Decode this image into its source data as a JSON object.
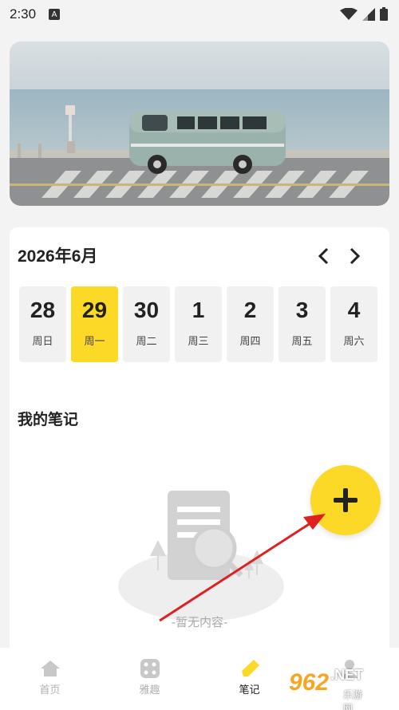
{
  "status_bar": {
    "time": "2:30",
    "notification_icon": "A"
  },
  "calendar": {
    "month_title": "2026年6月",
    "days": [
      {
        "num": "28",
        "weekday": "周日",
        "selected": false
      },
      {
        "num": "29",
        "weekday": "周一",
        "selected": true
      },
      {
        "num": "30",
        "weekday": "周二",
        "selected": false
      },
      {
        "num": "1",
        "weekday": "周三",
        "selected": false
      },
      {
        "num": "2",
        "weekday": "周四",
        "selected": false
      },
      {
        "num": "3",
        "weekday": "周五",
        "selected": false
      },
      {
        "num": "4",
        "weekday": "周六",
        "selected": false
      }
    ]
  },
  "notes": {
    "title": "我的笔记",
    "empty_text": "-暂无内容-"
  },
  "tabs": [
    {
      "label": "首页",
      "icon": "home-icon"
    },
    {
      "label": "雅趣",
      "icon": "dice-icon"
    },
    {
      "label": "笔记",
      "icon": "pencil-icon"
    },
    {
      "label": "",
      "icon": "profile-icon"
    }
  ],
  "watermark": {
    "number": "962",
    "suffix": ".NET",
    "subtitle": "乐游网"
  },
  "colors": {
    "accent": "#fcd926",
    "background": "#f3f3f3",
    "arrow": "#e01f1f"
  }
}
